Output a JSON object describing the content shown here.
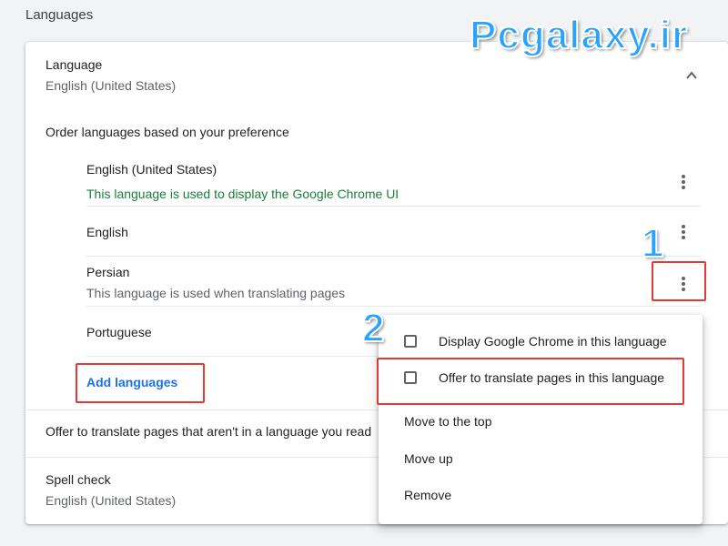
{
  "section": {
    "title": "Languages"
  },
  "watermark": {
    "text": "Pcgalaxy.ir"
  },
  "language_block": {
    "label": "Language",
    "value": "English (United States)",
    "order_heading": "Order languages based on your preference",
    "expand_icon": "chevron-up-icon"
  },
  "languages": [
    {
      "name": "English (United States)",
      "note": "This language is used to display the Google Chrome UI"
    },
    {
      "name": "English",
      "note": ""
    },
    {
      "name": "Persian",
      "note": "This language is used when translating pages"
    },
    {
      "name": "Portuguese",
      "note": ""
    }
  ],
  "add_languages_label": "Add languages",
  "offer_translate_label": "Offer to translate pages that aren't in a language you read",
  "spell_check": {
    "label": "Spell check",
    "value": "English (United States)"
  },
  "context_menu": {
    "checkbox_items": [
      {
        "label": "Display Google Chrome in this language",
        "checked": false
      },
      {
        "label": "Offer to translate pages in this language",
        "checked": false
      }
    ],
    "items": [
      "Move to the top",
      "Move up",
      "Remove"
    ]
  },
  "annotations": {
    "step1": "1",
    "step2": "2",
    "highlight_color": "#e53935",
    "number_color": "#2aa3ff"
  },
  "colors": {
    "accent": "#1a73e8",
    "note_green": "#188038"
  }
}
